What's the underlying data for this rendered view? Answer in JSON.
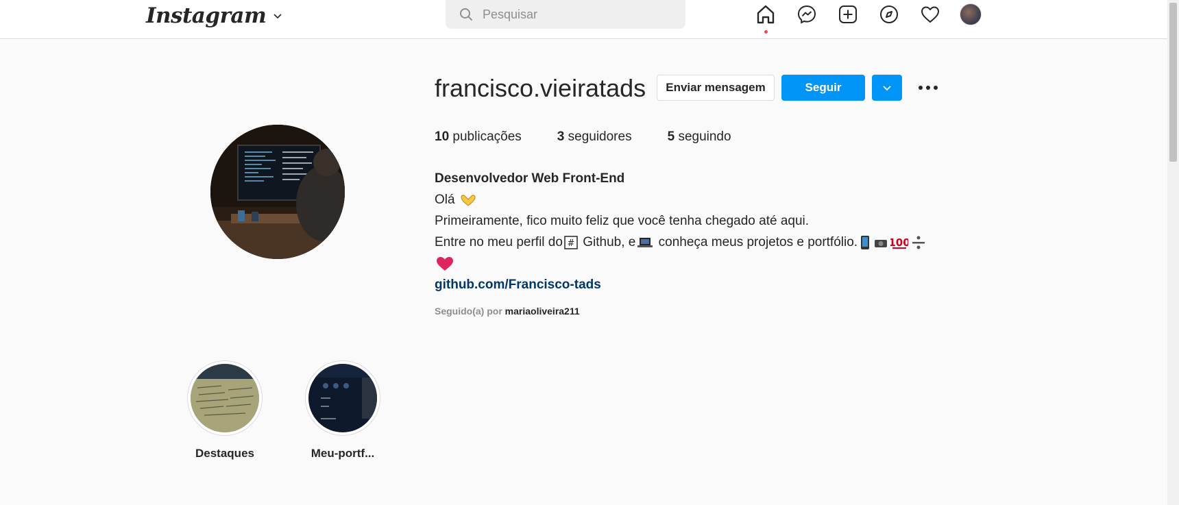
{
  "nav": {
    "logo": "Instagram",
    "search_placeholder": "Pesquisar",
    "icons": [
      "home-icon",
      "messenger-icon",
      "new-post-icon",
      "explore-icon",
      "activity-heart-icon",
      "profile-avatar"
    ]
  },
  "profile": {
    "username": "francisco.vieiratads",
    "message_button": "Enviar mensagem",
    "follow_button": "Seguir",
    "stats": [
      {
        "count": "10",
        "label": "publicações"
      },
      {
        "count": "3",
        "label": "seguidores"
      },
      {
        "count": "5",
        "label": "seguindo"
      }
    ],
    "bio": {
      "name": "Desenvolvedor Web Front-End",
      "line1": "Olá",
      "line2": "Primeiramente, fico muito feliz que você tenha chegado até aqui.",
      "line3a": "Entre no meu perfil do",
      "line3b": "Github, e",
      "line3c": "conheça meus projetos e portfólio.",
      "link": "github.com/Francisco-tads"
    },
    "followed_by_prefix": "Seguido(a) por",
    "followed_by_user": "mariaoliveira211"
  },
  "highlights": [
    {
      "label": "Destaques"
    },
    {
      "label": "Meu-portf..."
    }
  ],
  "colors": {
    "primary": "#0095f6",
    "link": "#00376b",
    "text": "#262626",
    "muted": "#8e8e8e",
    "background": "#fafafa",
    "notification": "#ed4956"
  }
}
